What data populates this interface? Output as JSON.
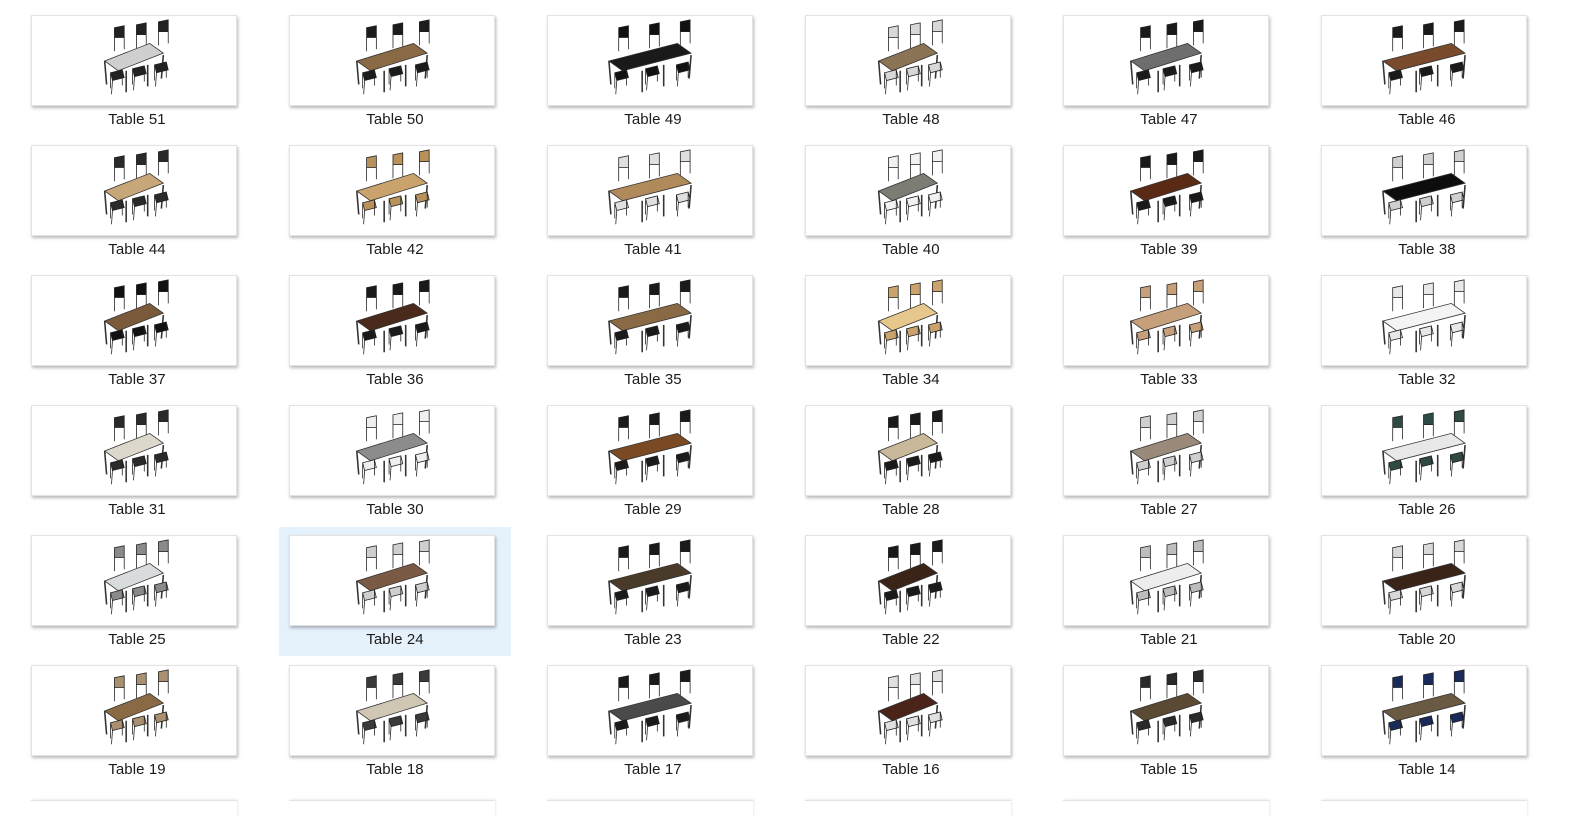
{
  "selected_index": 25,
  "items": [
    {
      "label": "Table 51",
      "top": "#cfcfcf",
      "chair": "#222222"
    },
    {
      "label": "Table 50",
      "top": "#8a6a44",
      "chair": "#1c1c1c"
    },
    {
      "label": "Table 49",
      "top": "#1a1a1a",
      "chair": "#111111"
    },
    {
      "label": "Table 48",
      "top": "#8b7355",
      "chair": "#d8d8d8"
    },
    {
      "label": "Table 47",
      "top": "#6e6e6e",
      "chair": "#1a1a1a"
    },
    {
      "label": "Table 46",
      "top": "#7a4a2c",
      "chair": "#1a1a1a"
    },
    {
      "label": "Table 44",
      "top": "#c7a67a",
      "chair": "#2a2a2a"
    },
    {
      "label": "Table 42",
      "top": "#c9a36b",
      "chair": "#b8925a"
    },
    {
      "label": "Table 41",
      "top": "#b08a5a",
      "chair": "#e0e0e0"
    },
    {
      "label": "Table 40",
      "top": "#7c7c74",
      "chair": "#f2f2f2"
    },
    {
      "label": "Table 39",
      "top": "#5a2a14",
      "chair": "#1a1a1a"
    },
    {
      "label": "Table 38",
      "top": "#0d0d0d",
      "chair": "#d0d0d0"
    },
    {
      "label": "Table 37",
      "top": "#7a5a3a",
      "chair": "#111111"
    },
    {
      "label": "Table 36",
      "top": "#4a2a1a",
      "chair": "#1a1a1a"
    },
    {
      "label": "Table 35",
      "top": "#8a6a44",
      "chair": "#1a1a1a"
    },
    {
      "label": "Table 34",
      "top": "#e6c88c",
      "chair": "#c9a36b"
    },
    {
      "label": "Table 33",
      "top": "#c6a07a",
      "chair": "#c6a07a"
    },
    {
      "label": "Table 32",
      "top": "#f4f4f4",
      "chair": "#e8e8e8"
    },
    {
      "label": "Table 31",
      "top": "#dcd8cc",
      "chair": "#2a2a2a"
    },
    {
      "label": "Table 30",
      "top": "#8c8c8c",
      "chair": "#efefef"
    },
    {
      "label": "Table 29",
      "top": "#7a4a24",
      "chair": "#1a1a1a"
    },
    {
      "label": "Table 28",
      "top": "#c9b89a",
      "chair": "#1a1a1a"
    },
    {
      "label": "Table 27",
      "top": "#9a8a7a",
      "chair": "#cfcfcf"
    },
    {
      "label": "Table 26",
      "top": "#e8e8e8",
      "chair": "#2f4a44"
    },
    {
      "label": "Table 25",
      "top": "#d8dcdc",
      "chair": "#8a8a8a"
    },
    {
      "label": "Table 24",
      "top": "#7a5a44",
      "chair": "#cfcfcf"
    },
    {
      "label": "Table 23",
      "top": "#4a3a2a",
      "chair": "#1a1a1a"
    },
    {
      "label": "Table 22",
      "top": "#3a2418",
      "chair": "#1a1a1a"
    },
    {
      "label": "Table 21",
      "top": "#ededed",
      "chair": "#bdbdbd"
    },
    {
      "label": "Table 20",
      "top": "#3a2418",
      "chair": "#d8d8d8"
    },
    {
      "label": "Table 19",
      "top": "#8a6a44",
      "chair": "#a89070"
    },
    {
      "label": "Table 18",
      "top": "#cfc6b4",
      "chair": "#3a3a3a"
    },
    {
      "label": "Table 17",
      "top": "#4a4a4a",
      "chair": "#1a1a1a"
    },
    {
      "label": "Table 16",
      "top": "#4a2418",
      "chair": "#e0e0e0"
    },
    {
      "label": "Table 15",
      "top": "#5a4a34",
      "chair": "#2a2a2a"
    },
    {
      "label": "Table 14",
      "top": "#6a5a44",
      "chair": "#1a2a5a"
    }
  ]
}
